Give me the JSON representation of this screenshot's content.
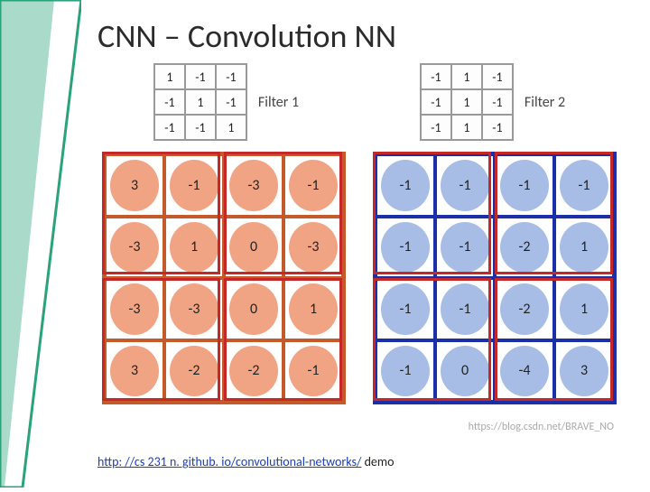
{
  "title": "CNN – Convolution NN",
  "filter1": {
    "label": "Filter 1",
    "grid": [
      [
        1,
        -1,
        -1
      ],
      [
        -1,
        1,
        -1
      ],
      [
        -1,
        -1,
        1
      ]
    ]
  },
  "filter2": {
    "label": "Filter 2",
    "grid": [
      [
        -1,
        1,
        -1
      ],
      [
        -1,
        1,
        -1
      ],
      [
        -1,
        1,
        -1
      ]
    ]
  },
  "output1": {
    "grid": [
      [
        3,
        -1,
        -3,
        -1
      ],
      [
        -3,
        1,
        0,
        -3
      ],
      [
        -3,
        -3,
        0,
        1
      ],
      [
        3,
        -2,
        -2,
        -1
      ]
    ],
    "pool_boxes": [
      [
        0,
        0
      ],
      [
        0,
        2
      ],
      [
        2,
        0
      ],
      [
        2,
        2
      ]
    ]
  },
  "output2": {
    "grid": [
      [
        -1,
        -1,
        -1,
        -1
      ],
      [
        -1,
        -1,
        -2,
        1
      ],
      [
        -1,
        -1,
        -2,
        1
      ],
      [
        -1,
        0,
        -4,
        3
      ]
    ],
    "pool_boxes": [
      [
        0,
        0
      ],
      [
        0,
        2
      ],
      [
        2,
        0
      ],
      [
        2,
        2
      ]
    ]
  },
  "watermark": "https://blog.csdn.net/BRAVE_NO",
  "link": {
    "url_text": "http: //cs 231 n. github. io/convolutional-networks/",
    "href": "http://cs231n.github.io/convolutional-networks/",
    "suffix": " demo"
  }
}
